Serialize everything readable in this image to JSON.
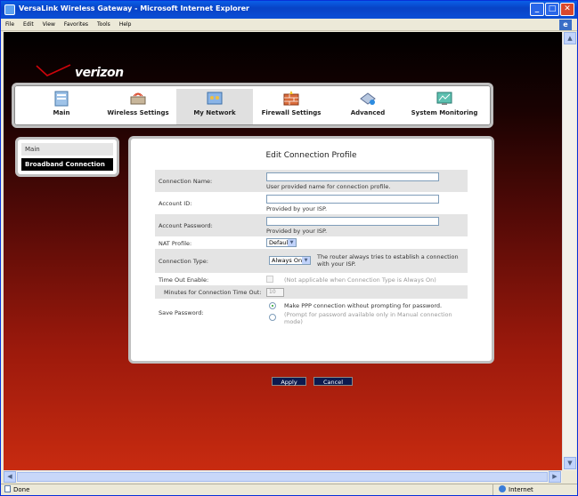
{
  "window": {
    "title": "VersaLink Wireless Gateway - Microsoft Internet Explorer",
    "controls": {
      "minimize": "_",
      "maximize": "□",
      "close": "✕"
    }
  },
  "menu": [
    "File",
    "Edit",
    "View",
    "Favorites",
    "Tools",
    "Help"
  ],
  "brand": {
    "logo_text": "verizon",
    "accent": "#CD040B"
  },
  "nav": [
    {
      "label": "Main",
      "icon": "main-icon",
      "active": false
    },
    {
      "label": "Wireless Settings",
      "icon": "wireless-settings-icon",
      "active": false
    },
    {
      "label": "My Network",
      "icon": "my-network-icon",
      "active": true
    },
    {
      "label": "Firewall Settings",
      "icon": "firewall-icon",
      "active": false
    },
    {
      "label": "Advanced",
      "icon": "advanced-icon",
      "active": false
    },
    {
      "label": "System Monitoring",
      "icon": "system-monitoring-icon",
      "active": false
    }
  ],
  "sidebar": {
    "items": [
      {
        "label": "Main",
        "active": false
      },
      {
        "label": "Broadband Connection",
        "active": true
      }
    ]
  },
  "form": {
    "title": "Edit Connection Profile",
    "connection_name": {
      "label": "Connection Name:",
      "value": "",
      "hint": "User provided name for connection profile."
    },
    "account_id": {
      "label": "Account ID:",
      "value": "",
      "hint": "Provided by your ISP."
    },
    "account_password": {
      "label": "Account Password:",
      "value": "",
      "hint": "Provided by your ISP."
    },
    "nat_profile": {
      "label": "NAT Profile:",
      "value": "Default"
    },
    "connection_type": {
      "label": "Connection Type:",
      "value": "Always On",
      "hint": "The router always tries to establish a connection with your ISP."
    },
    "timeout_enable": {
      "label": "Time Out Enable:",
      "checked": false,
      "hint": "(Not applicable when Connection Type is Always On)"
    },
    "timeout_minutes": {
      "label": "Minutes for Connection Time Out:",
      "value": "10"
    },
    "save_password": {
      "label": "Save Password:",
      "option1": "Make PPP connection without prompting for password.",
      "option2": "(Prompt for password available only in Manual connection mode)",
      "selected": 1
    },
    "apply": "Apply",
    "cancel": "Cancel"
  },
  "status": {
    "text": "Done",
    "zone": "Internet"
  }
}
